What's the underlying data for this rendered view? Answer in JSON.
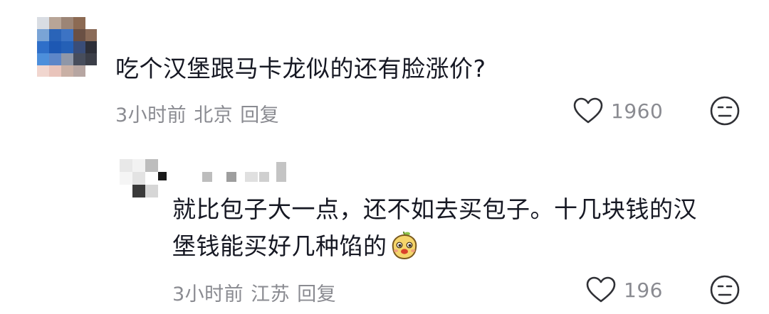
{
  "comments": [
    {
      "text": "吃个汉堡跟马卡龙似的还有脸涨价?",
      "time": "3小时前",
      "location": "北京",
      "reply_label": "回复",
      "likes": "1960"
    }
  ],
  "reply": {
    "line1": "就比包子大一点，还不如去买包子。十几块钱的汉",
    "line2": "堡钱能买好几种馅的",
    "time": "3小时前",
    "location": "江苏",
    "reply_label": "回复",
    "likes": "196"
  },
  "icons": {
    "like": "heart-outline-icon",
    "dislike": "meh-face-icon",
    "emoji": "bun-mascot-emoji"
  },
  "colors": {
    "text": "#161823",
    "meta": "#8a8b91",
    "icon": "#2f3035"
  }
}
